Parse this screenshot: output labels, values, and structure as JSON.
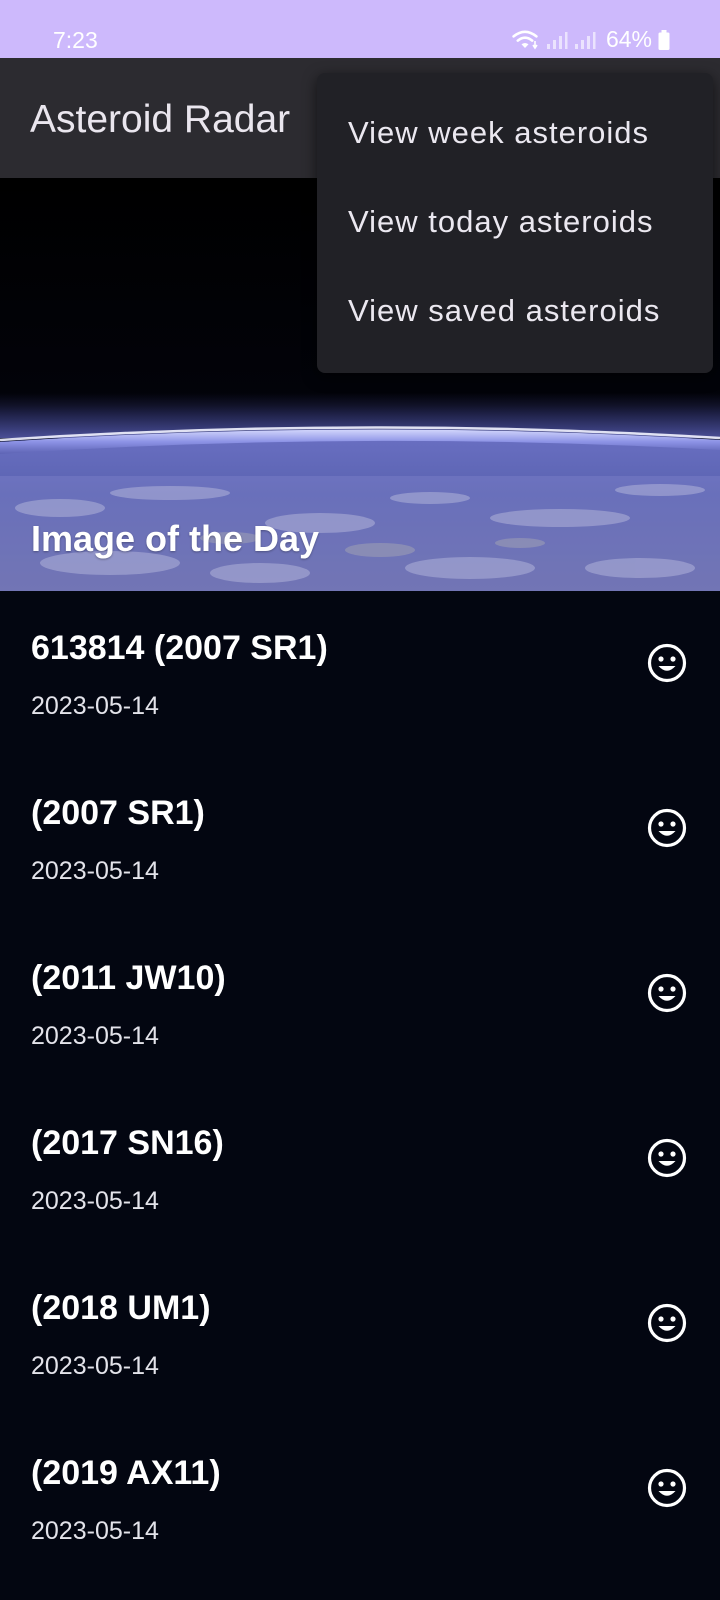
{
  "status_bar": {
    "time": "7:23",
    "battery": "64%",
    "icons": [
      "wifi-icon",
      "signal-icon",
      "signal-icon",
      "battery-icon"
    ]
  },
  "app_bar": {
    "title": "Asteroid Radar"
  },
  "image_of_day": {
    "title": "Image of the Day"
  },
  "asteroids": [
    {
      "name": "613814 (2007 SR1)",
      "date": "2023-05-14",
      "status_icon": "smile-icon"
    },
    {
      "name": "(2007 SR1)",
      "date": "2023-05-14",
      "status_icon": "smile-icon"
    },
    {
      "name": "(2011 JW10)",
      "date": "2023-05-14",
      "status_icon": "smile-icon"
    },
    {
      "name": "(2017 SN16)",
      "date": "2023-05-14",
      "status_icon": "smile-icon"
    },
    {
      "name": "(2018 UM1)",
      "date": "2023-05-14",
      "status_icon": "smile-icon"
    },
    {
      "name": "(2019 AX11)",
      "date": "2023-05-14",
      "status_icon": "smile-icon"
    }
  ],
  "menu": {
    "items": [
      {
        "label": "View week asteroids"
      },
      {
        "label": "View today asteroids"
      },
      {
        "label": "View saved asteroids"
      }
    ]
  },
  "colors": {
    "status_bar_bg": "#cdb9fc",
    "app_bar_bg": "#2c2b30",
    "list_bg": "#030611",
    "menu_bg": "#212126"
  }
}
